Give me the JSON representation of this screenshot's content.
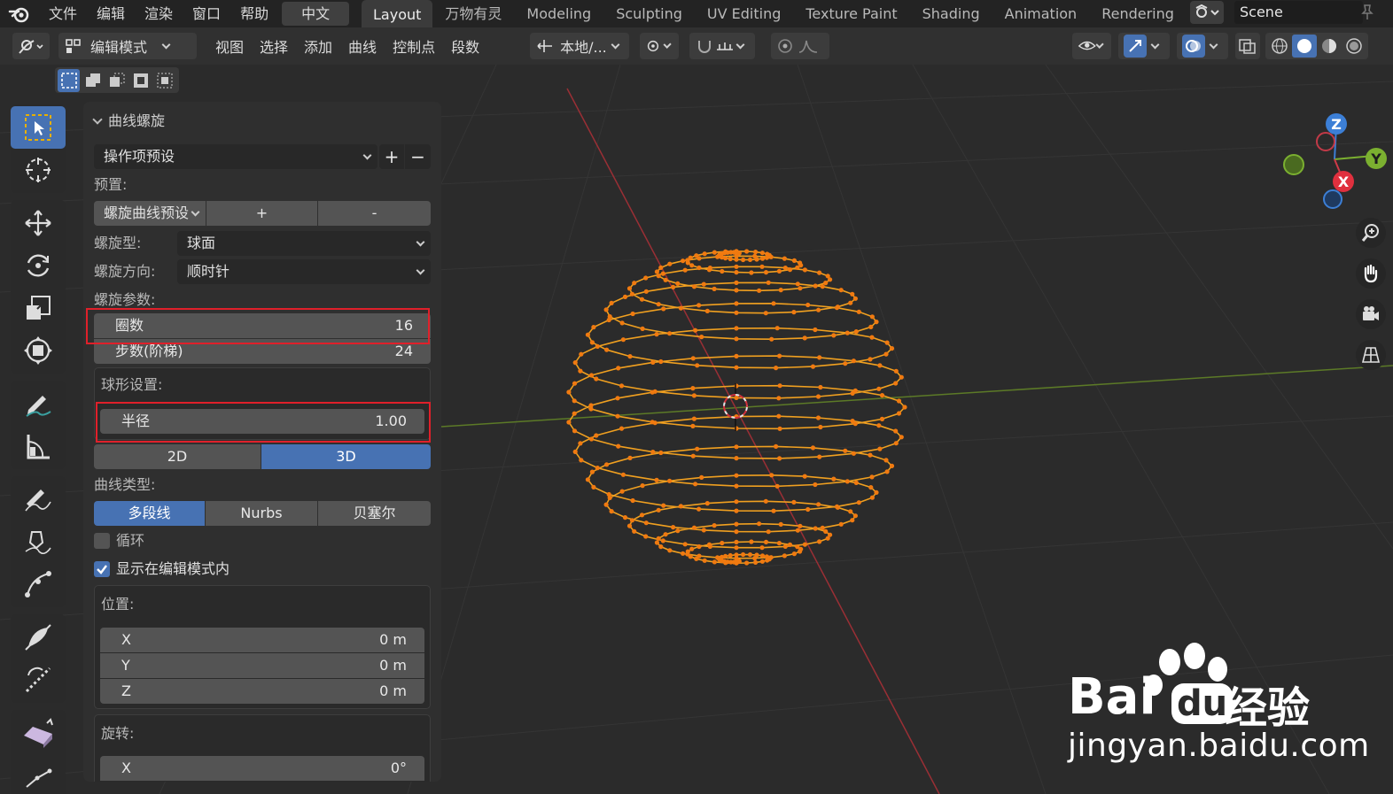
{
  "topbar": {
    "menus": [
      "文件",
      "编辑",
      "渲染",
      "窗口",
      "帮助"
    ],
    "language": "中文",
    "workspaces": [
      "Layout",
      "万物有灵",
      "Modeling",
      "Sculpting",
      "UV Editing",
      "Texture Paint",
      "Shading",
      "Animation",
      "Rendering"
    ],
    "active_workspace": "Layout",
    "scene": "Scene"
  },
  "header": {
    "mode": "编辑模式",
    "menus": [
      "视图",
      "选择",
      "添加",
      "曲线",
      "控制点",
      "段数"
    ],
    "orientation": "本地/..."
  },
  "panel": {
    "title": "曲线螺旋",
    "operator_preset": "操作项预设",
    "add_symbol": "+",
    "remove_symbol": "−",
    "preset_label": "预置:",
    "preset_value": "螺旋曲线预设",
    "preset_add": "+",
    "preset_remove": "-",
    "spiral_type_label": "螺旋型:",
    "spiral_type_value": "球面",
    "direction_label": "螺旋方向:",
    "direction_value": "顺时针",
    "params_label": "螺旋参数:",
    "turns_label": "圈数",
    "turns_value": "16",
    "steps_label": "步数(阶梯)",
    "steps_value": "24",
    "sphere_label": "球形设置:",
    "radius_label": "半径",
    "radius_value": "1.00",
    "dim_2d": "2D",
    "dim_3d": "3D",
    "active_dim": "3D",
    "curve_type_label": "曲线类型:",
    "curve_types": [
      "多段线",
      "Nurbs",
      "贝塞尔"
    ],
    "active_curve_type": "多段线",
    "cyclic_label": "循环",
    "cyclic_checked": false,
    "show_edit_label": "显示在编辑模式内",
    "show_edit_checked": true,
    "location_label": "位置:",
    "location": [
      {
        "axis": "X",
        "value": "0 m"
      },
      {
        "axis": "Y",
        "value": "0 m"
      },
      {
        "axis": "Z",
        "value": "0 m"
      }
    ],
    "rotation_label": "旋转:",
    "rotation": [
      {
        "axis": "X",
        "value": "0°"
      }
    ]
  },
  "gizmo": {
    "z": "Z",
    "y": "Y",
    "x": "X"
  },
  "watermark": {
    "brand": "Bai",
    "brand_du": "du",
    "brand_cn": "经验",
    "url": "jingyan.baidu.com"
  },
  "colors": {
    "accent": "#4772b3",
    "curve": "#f0a020",
    "highlight_box": "#e0202a",
    "x_axis": "#c83a40",
    "y_axis": "#6a9a2a"
  }
}
